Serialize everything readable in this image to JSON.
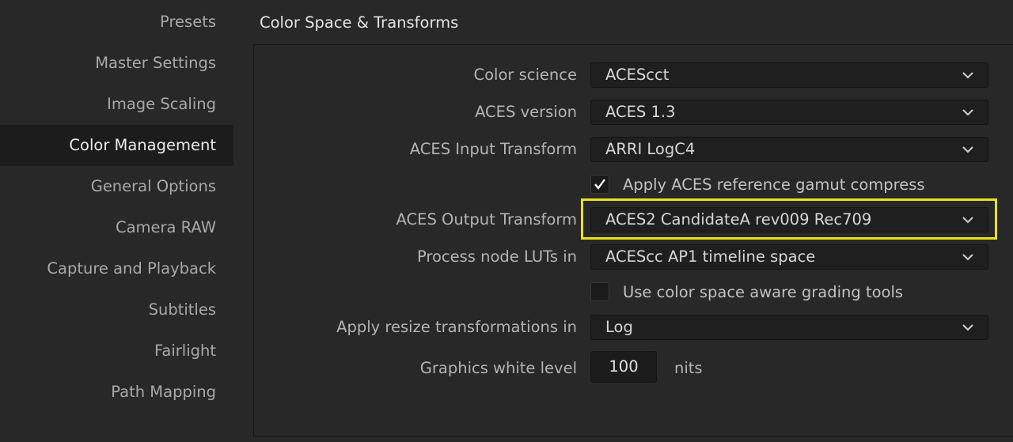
{
  "sidebar": {
    "items": [
      {
        "label": "Presets"
      },
      {
        "label": "Master Settings"
      },
      {
        "label": "Image Scaling"
      },
      {
        "label": "Color Management",
        "active": true
      },
      {
        "label": "General Options"
      },
      {
        "label": "Camera RAW"
      },
      {
        "label": "Capture and Playback"
      },
      {
        "label": "Subtitles"
      },
      {
        "label": "Fairlight"
      },
      {
        "label": "Path Mapping"
      }
    ]
  },
  "section": {
    "title": "Color Space & Transforms"
  },
  "fields": {
    "color_science": {
      "label": "Color science",
      "value": "ACEScct"
    },
    "aces_version": {
      "label": "ACES version",
      "value": "ACES 1.3"
    },
    "aces_input": {
      "label": "ACES Input Transform",
      "value": "ARRI LogC4"
    },
    "gamut_compress": {
      "label": "Apply ACES reference gamut compress",
      "checked": true
    },
    "aces_output": {
      "label": "ACES Output Transform",
      "value": "ACES2 CandidateA rev009 Rec709"
    },
    "process_luts": {
      "label": "Process node LUTs in",
      "value": "ACEScc AP1 timeline space"
    },
    "color_aware": {
      "label": "Use color space aware grading tools",
      "checked": false
    },
    "resize_transform": {
      "label": "Apply resize transformations in",
      "value": "Log"
    },
    "white_level": {
      "label": "Graphics white level",
      "value": "100",
      "unit": "nits"
    }
  },
  "icons": {
    "dropdown": "chevron-down-icon",
    "check": "checkmark-icon"
  },
  "colors": {
    "background": "#282828",
    "sidebar_active": "#1c1c1c",
    "highlight": "#e9e320",
    "field_bg": "#1f1f1f"
  }
}
